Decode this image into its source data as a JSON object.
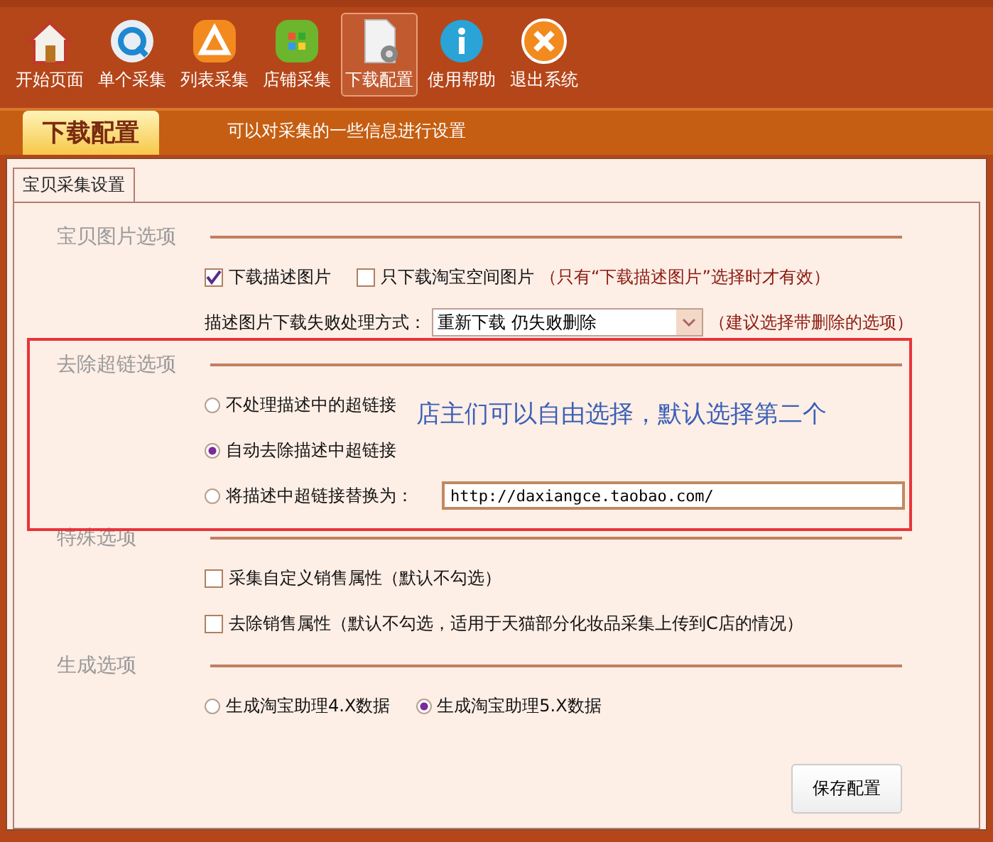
{
  "toolbar": [
    {
      "label": "开始页面",
      "selected": false
    },
    {
      "label": "单个采集",
      "selected": false
    },
    {
      "label": "列表采集",
      "selected": false
    },
    {
      "label": "店铺采集",
      "selected": false
    },
    {
      "label": "下载配置",
      "selected": true
    },
    {
      "label": "使用帮助",
      "selected": false
    },
    {
      "label": "退出系统",
      "selected": false
    }
  ],
  "header": {
    "tab": "下载配置",
    "description": "可以对采集的一些信息进行设置"
  },
  "tabs": [
    {
      "label": "宝贝采集设置",
      "selected": true
    }
  ],
  "sections": [
    {
      "title": "宝贝图片选项",
      "rows": [
        {
          "kind": "checks",
          "items": [
            {
              "label": "下载描述图片",
              "checked": true
            },
            {
              "label": "只下载淘宝空间图片",
              "checked": false,
              "note": "（只有“下载描述图片”选择时才有效）"
            }
          ]
        },
        {
          "kind": "select",
          "label": "描述图片下载失败处理方式：",
          "value": "重新下载 仍失败删除",
          "note": "（建议选择带删除的选项）"
        }
      ]
    },
    {
      "title": "去除超链选项",
      "rows": [
        {
          "kind": "radio",
          "label": "不处理描述中的超链接",
          "selected": false
        },
        {
          "kind": "radio",
          "label": "自动去除描述中超链接",
          "selected": true
        },
        {
          "kind": "radio",
          "label": "将描述中超链接替换为：",
          "selected": false,
          "value": "http://daxiangce.taobao.com/"
        }
      ]
    },
    {
      "title": "特殊选项",
      "rows": [
        {
          "kind": "checks",
          "items": [
            {
              "label": "采集自定义销售属性（默认不勾选）",
              "checked": false
            }
          ]
        },
        {
          "kind": "checks",
          "items": [
            {
              "label": "去除销售属性（默认不勾选，适用于天猫部分化妆品采集上传到C店的情况）",
              "checked": false
            }
          ]
        }
      ]
    },
    {
      "title": "生成选项",
      "rows": [
        {
          "kind": "radios",
          "items": [
            {
              "label": "生成淘宝助理4.X数据",
              "selected": false
            },
            {
              "label": "生成淘宝助理5.X数据",
              "selected": true
            }
          ]
        }
      ]
    }
  ],
  "save_button": "保存配置",
  "annotation": {
    "text": "店主们可以自由选择，默认选择第二个"
  }
}
